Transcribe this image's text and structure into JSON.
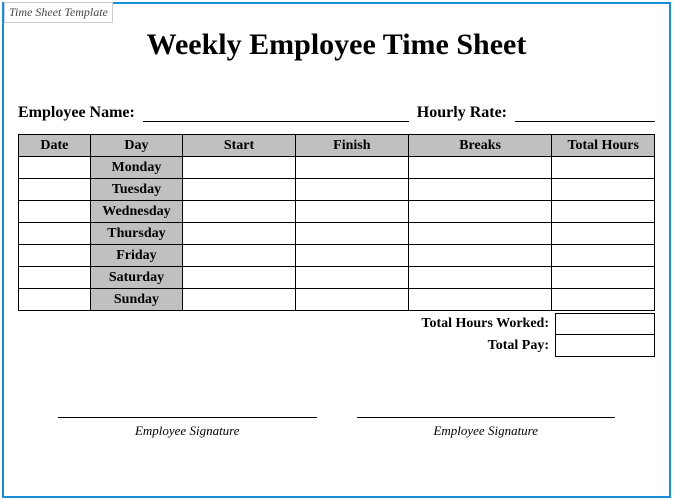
{
  "template_label": "Time Sheet Template",
  "title": "Weekly Employee Time Sheet",
  "fields": {
    "employee_name_label": "Employee Name:",
    "hourly_rate_label": "Hourly Rate:"
  },
  "columns": {
    "date": "Date",
    "day": "Day",
    "start": "Start",
    "finish": "Finish",
    "breaks": "Breaks",
    "total_hours": "Total Hours"
  },
  "days": [
    "Monday",
    "Tuesday",
    "Wednesday",
    "Thursday",
    "Friday",
    "Saturday",
    "Sunday"
  ],
  "totals": {
    "total_hours_worked_label": "Total Hours Worked:",
    "total_pay_label": "Total Pay:"
  },
  "signatures": {
    "left": "Employee Signature",
    "right": "Employee Signature"
  },
  "chart_data": {
    "type": "table",
    "columns": [
      "Date",
      "Day",
      "Start",
      "Finish",
      "Breaks",
      "Total Hours"
    ],
    "rows": [
      {
        "Date": "",
        "Day": "Monday",
        "Start": "",
        "Finish": "",
        "Breaks": "",
        "Total Hours": ""
      },
      {
        "Date": "",
        "Day": "Tuesday",
        "Start": "",
        "Finish": "",
        "Breaks": "",
        "Total Hours": ""
      },
      {
        "Date": "",
        "Day": "Wednesday",
        "Start": "",
        "Finish": "",
        "Breaks": "",
        "Total Hours": ""
      },
      {
        "Date": "",
        "Day": "Thursday",
        "Start": "",
        "Finish": "",
        "Breaks": "",
        "Total Hours": ""
      },
      {
        "Date": "",
        "Day": "Friday",
        "Start": "",
        "Finish": "",
        "Breaks": "",
        "Total Hours": ""
      },
      {
        "Date": "",
        "Day": "Saturday",
        "Start": "",
        "Finish": "",
        "Breaks": "",
        "Total Hours": ""
      },
      {
        "Date": "",
        "Day": "Sunday",
        "Start": "",
        "Finish": "",
        "Breaks": "",
        "Total Hours": ""
      }
    ],
    "totals": {
      "Total Hours Worked": "",
      "Total Pay": ""
    }
  }
}
